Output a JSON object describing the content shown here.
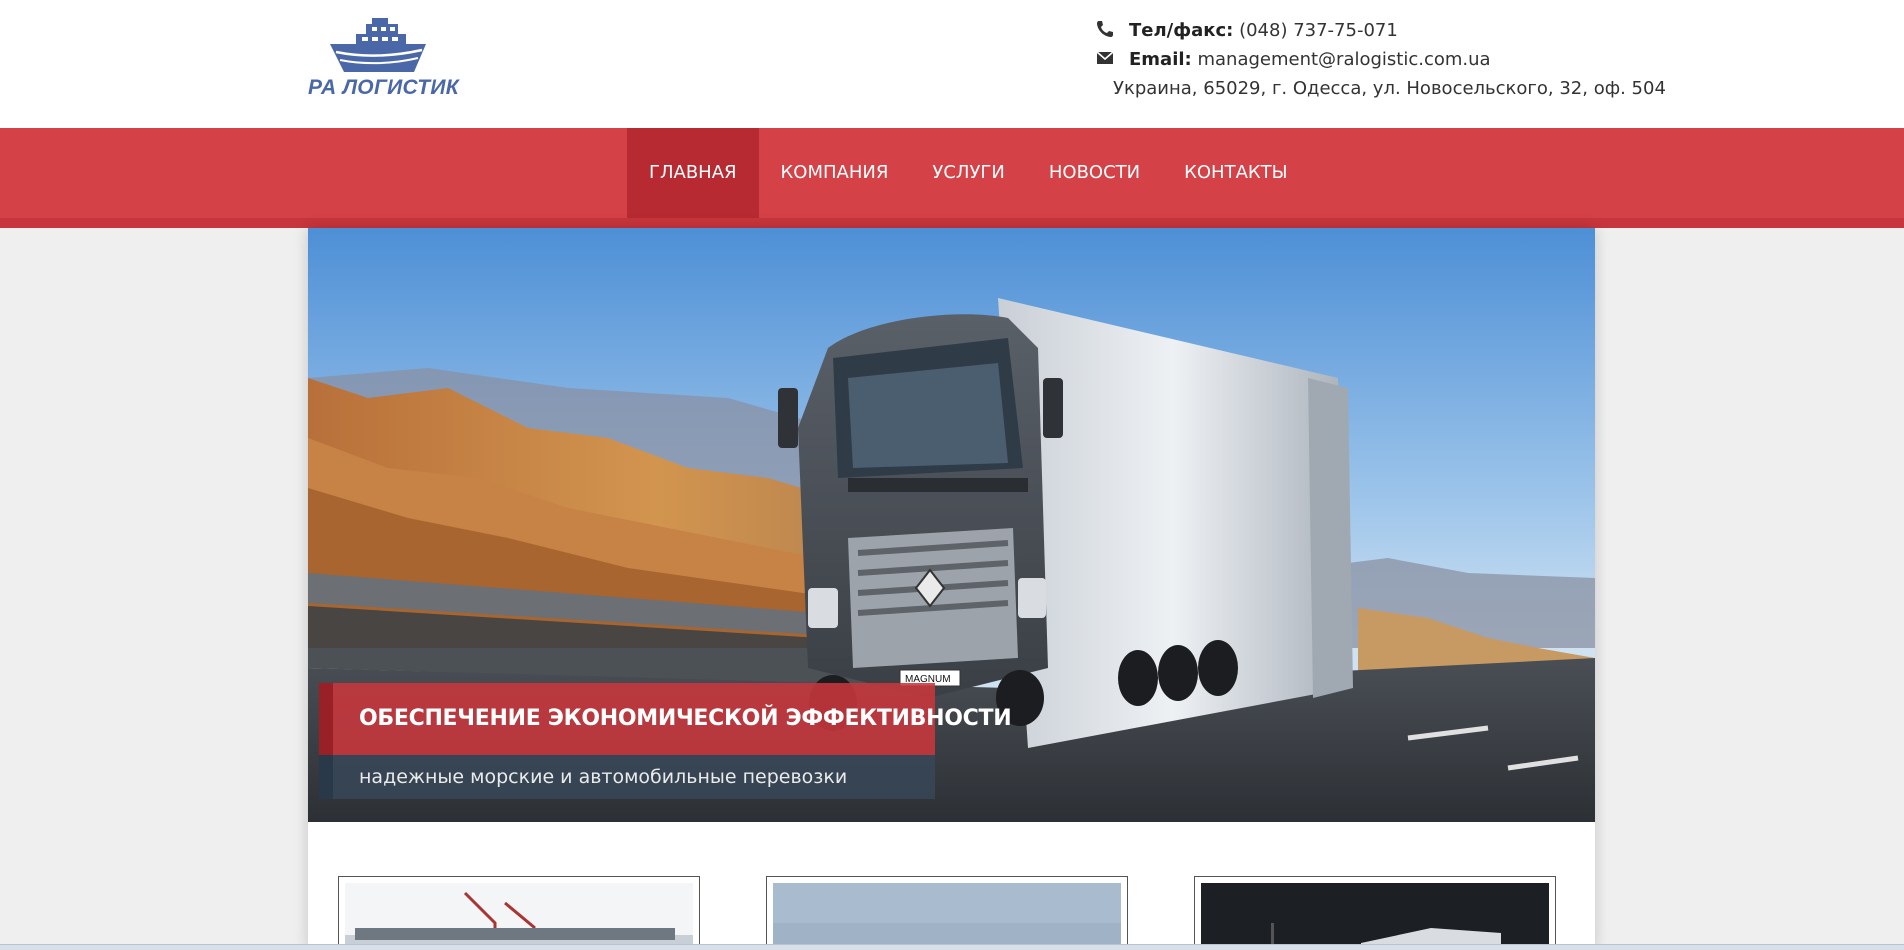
{
  "header": {
    "logo_text": "РА ЛОГИСТИК",
    "logo_icon": "ship-icon",
    "phone": {
      "label": "Тел/факс:",
      "value": "(048) 737-75-071",
      "icon": "phone-icon"
    },
    "email": {
      "label": "Email:",
      "value": "management@ralogistic.com.ua",
      "icon": "envelope-icon"
    },
    "address": "Украина, 65029, г. Одесса, ул. Новосельского, 32, оф. 504"
  },
  "nav": {
    "items": [
      {
        "label": "ГЛАВНАЯ",
        "active": true
      },
      {
        "label": "КОМПАНИЯ",
        "active": false
      },
      {
        "label": "УСЛУГИ",
        "active": false
      },
      {
        "label": "НОВОСТИ",
        "active": false
      },
      {
        "label": "КОНТАКТЫ",
        "active": false
      }
    ]
  },
  "hero": {
    "title": "ОБЕСПЕЧЕНИЕ ЭКОНОМИЧЕСКОЙ ЭФФЕКТИВНОСТИ",
    "subtitle": "надежные морские и автомобильные перевозки",
    "plate": "MAGNUM"
  },
  "colors": {
    "nav_bg": "#d44147",
    "nav_active": "#b72a31",
    "logo_blue": "#4a68a8",
    "page_bg": "#efefef"
  }
}
